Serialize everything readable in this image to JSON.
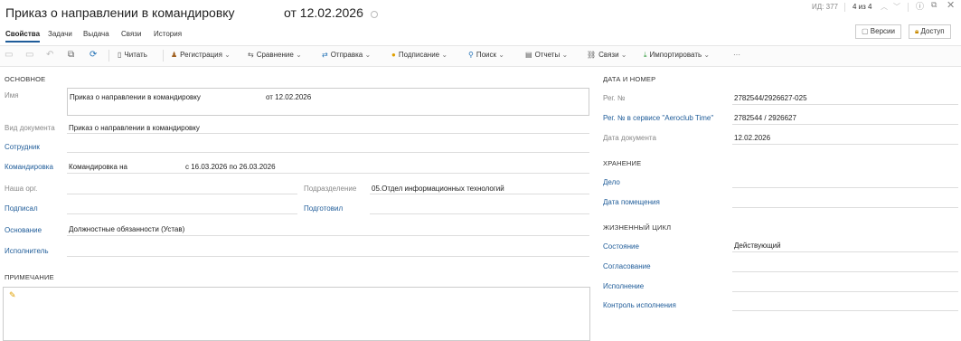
{
  "header": {
    "title": "Приказ о направлении в командировку",
    "title_date": "от 12.02.2026",
    "id_label": "ИД: 377",
    "counter": "4 из 4",
    "star_icon": "star-outline-icon",
    "status_icon": "circle-icon"
  },
  "tabs": [
    "Свойства",
    "Задачи",
    "Выдача",
    "Связи",
    "История"
  ],
  "top_buttons": {
    "versions": "Версии",
    "access": "Доступ"
  },
  "toolbar": {
    "read": "Читать",
    "registration": "Регистрация",
    "compare": "Сравнение",
    "send": "Отправка",
    "sign": "Подписание",
    "search": "Поиск",
    "reports": "Отчеты",
    "links": "Связи",
    "import": "Импортировать",
    "more": "···"
  },
  "main": {
    "section": "ОСНОВНОЕ",
    "name_label": "Имя",
    "name_value": "Приказ о направлении в командировку",
    "name_date": "от 12.02.2026",
    "doctype_label": "Вид документа",
    "doctype_value": "Приказ о направлении в командировку",
    "employee_label": "Сотрудник",
    "trip_label": "Командировка",
    "trip_value": "Командировка на",
    "trip_dates": "с 16.03.2026 по 26.03.2026",
    "org_label": "Наша орг.",
    "dept_label": "Подразделение",
    "dept_value": "05.Отдел информационных технологий",
    "signed_label": "Подписал",
    "prepared_label": "Подготовил",
    "basis_label": "Основание",
    "basis_value": "Должностные обязанности (Устав)",
    "executor_label": "Исполнитель",
    "note_section": "ПРИМЕЧАНИЕ"
  },
  "right": {
    "date_section": "ДАТА И НОМЕР",
    "reg_label": "Рег. №",
    "reg_value": "2782544/2926627-025",
    "reg_service_label": "Рег. № в сервисе \"Aeroclub Time\"",
    "reg_service_value": "2782544 / 2926627",
    "doc_date_label": "Дата документа",
    "doc_date_value": "12.02.2026",
    "storage_section": "ХРАНЕНИЕ",
    "case_label": "Дело",
    "placed_label": "Дата помещения",
    "life_section": "ЖИЗНЕННЫЙ ЦИКЛ",
    "state_label": "Состояние",
    "state_value": "Действующий",
    "approval_label": "Согласование",
    "execution_label": "Исполнение",
    "control_label": "Контроль исполнения"
  }
}
